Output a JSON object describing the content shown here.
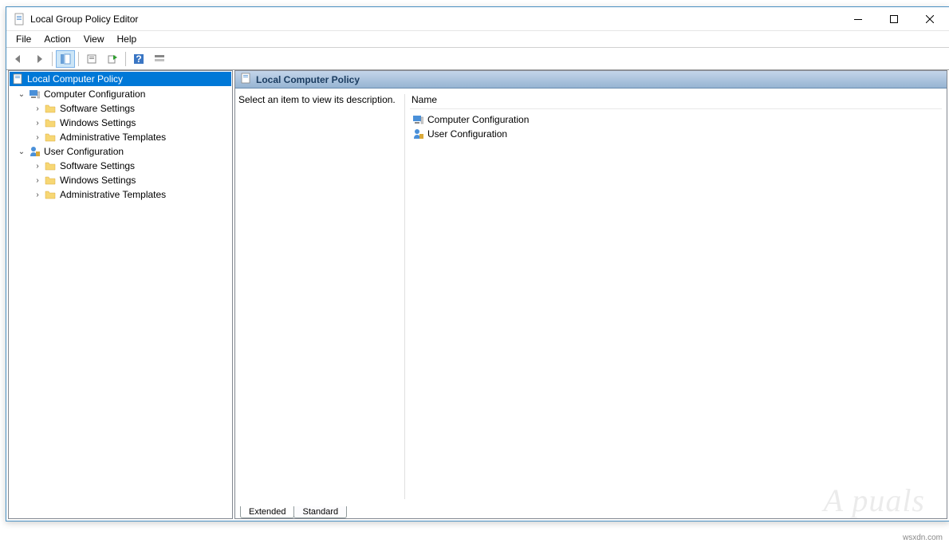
{
  "window": {
    "title": "Local Group Policy Editor"
  },
  "menubar": {
    "items": [
      "File",
      "Action",
      "View",
      "Help"
    ]
  },
  "tree": {
    "root": "Local Computer Policy",
    "computer_config": {
      "label": "Computer Configuration",
      "children": [
        "Software Settings",
        "Windows Settings",
        "Administrative Templates"
      ]
    },
    "user_config": {
      "label": "User Configuration",
      "children": [
        "Software Settings",
        "Windows Settings",
        "Administrative Templates"
      ]
    }
  },
  "right": {
    "header": "Local Computer Policy",
    "description_prompt": "Select an item to view its description.",
    "column_name": "Name",
    "items": [
      "Computer Configuration",
      "User Configuration"
    ]
  },
  "tabs": {
    "extended": "Extended",
    "standard": "Standard"
  },
  "watermark": "A puals",
  "wsxdn": "wsxdn.com"
}
